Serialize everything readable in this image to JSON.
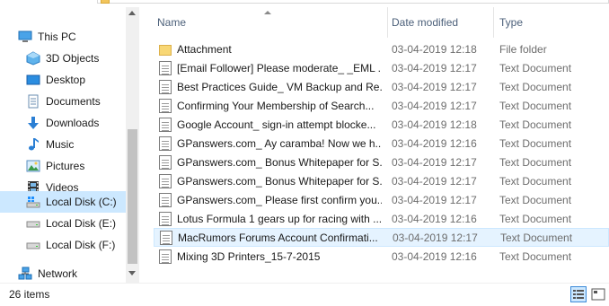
{
  "navigation": {
    "items": [
      {
        "label": "This PC",
        "icon": "monitor-icon"
      },
      {
        "label": "3D Objects",
        "icon": "cube-icon"
      },
      {
        "label": "Desktop",
        "icon": "desktop-icon"
      },
      {
        "label": "Documents",
        "icon": "documents-icon"
      },
      {
        "label": "Downloads",
        "icon": "download-arrow-icon"
      },
      {
        "label": "Music",
        "icon": "music-note-icon"
      },
      {
        "label": "Pictures",
        "icon": "pictures-icon"
      },
      {
        "label": "Videos",
        "icon": "film-icon"
      },
      {
        "label": "Local Disk (C:)",
        "icon": "windows-drive-icon"
      },
      {
        "label": "Local Disk (E:)",
        "icon": "drive-icon"
      },
      {
        "label": "Local Disk (F:)",
        "icon": "drive-icon"
      },
      {
        "label": "Network",
        "icon": "network-icon"
      }
    ],
    "selected": "Local Disk (C:)"
  },
  "columns": {
    "name": "Name",
    "date": "Date modified",
    "type": "Type"
  },
  "files": [
    {
      "name": "Attachment",
      "date": "03-04-2019 12:18",
      "type": "File folder",
      "kind": "folder"
    },
    {
      "name": "[Email Follower] Please moderate_ _EML ...",
      "date": "03-04-2019 12:17",
      "type": "Text Document",
      "kind": "doc"
    },
    {
      "name": "Best Practices Guide_ VM Backup and Re...",
      "date": "03-04-2019 12:17",
      "type": "Text Document",
      "kind": "doc"
    },
    {
      "name": "Confirming Your Membership of Search...",
      "date": "03-04-2019 12:17",
      "type": "Text Document",
      "kind": "doc"
    },
    {
      "name": "Google Account_ sign-in attempt blocke...",
      "date": "03-04-2019 12:18",
      "type": "Text Document",
      "kind": "doc"
    },
    {
      "name": "GPanswers.com_ Ay caramba! Now we h...",
      "date": "03-04-2019 12:16",
      "type": "Text Document",
      "kind": "doc"
    },
    {
      "name": "GPanswers.com_ Bonus Whitepaper for S...",
      "date": "03-04-2019 12:17",
      "type": "Text Document",
      "kind": "doc"
    },
    {
      "name": "GPanswers.com_ Bonus Whitepaper for S...",
      "date": "03-04-2019 12:17",
      "type": "Text Document",
      "kind": "doc"
    },
    {
      "name": "GPanswers.com_ Please first confirm you...",
      "date": "03-04-2019 12:17",
      "type": "Text Document",
      "kind": "doc"
    },
    {
      "name": "Lotus Formula 1 gears up for racing with ...",
      "date": "03-04-2019 12:16",
      "type": "Text Document",
      "kind": "doc"
    },
    {
      "name": "MacRumors Forums Account Confirmati...",
      "date": "03-04-2019 12:17",
      "type": "Text Document",
      "kind": "doc"
    },
    {
      "name": "Mixing 3D Printers_15-7-2015",
      "date": "03-04-2019 12:16",
      "type": "Text Document",
      "kind": "doc"
    }
  ],
  "hovered_row": 10,
  "status": {
    "item_count": "26 items"
  }
}
